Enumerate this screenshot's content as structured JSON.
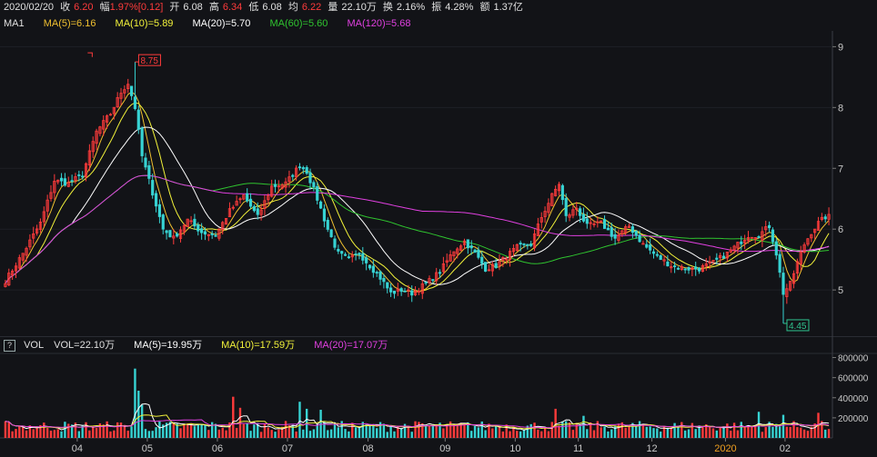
{
  "header": {
    "date": "2020/02/20",
    "items": [
      {
        "label": "收",
        "value": "6.20",
        "color": "#ff3b3b"
      },
      {
        "label": "幅",
        "value": "1.97%[0.12]",
        "color": "#ff3b3b"
      },
      {
        "label": "开",
        "value": "6.08",
        "color": "#e0e0e0"
      },
      {
        "label": "高",
        "value": "6.34",
        "color": "#ff3b3b"
      },
      {
        "label": "低",
        "value": "6.08",
        "color": "#e0e0e0"
      },
      {
        "label": "均",
        "value": "6.22",
        "color": "#ff3b3b"
      },
      {
        "label": "量",
        "value": "22.10万",
        "color": "#e0e0e0"
      },
      {
        "label": "换",
        "value": "2.16%",
        "color": "#e0e0e0"
      },
      {
        "label": "振",
        "value": "4.28%",
        "color": "#e0e0e0"
      },
      {
        "label": "额",
        "value": "1.37亿",
        "color": "#e0e0e0"
      }
    ]
  },
  "ma_legend": {
    "name": "MA1",
    "items": [
      {
        "text": "MA(5)=6.16",
        "color": "#f0c030"
      },
      {
        "text": "MA(10)=5.89",
        "color": "#f2f23a"
      },
      {
        "text": "MA(20)=5.70",
        "color": "#ffffff"
      },
      {
        "text": "MA(60)=5.60",
        "color": "#2fc42f"
      },
      {
        "text": "MA(120)=5.68",
        "color": "#e040e0"
      }
    ]
  },
  "vol_legend": {
    "help": "?",
    "name": "VOL",
    "items": [
      {
        "text": "VOL=22.10万",
        "color": "#e0e0e0"
      },
      {
        "text": "MA(5)=19.95万",
        "color": "#ffffff"
      },
      {
        "text": "MA(10)=17.59万",
        "color": "#f2f23a"
      },
      {
        "text": "MA(20)=17.07万",
        "color": "#e040e0"
      }
    ]
  },
  "chart_data": {
    "type": "candlestick",
    "price_axis": {
      "ticks": [
        "9",
        "8",
        "7",
        "6",
        "5"
      ],
      "tick_values": [
        9,
        8,
        7,
        6,
        5
      ],
      "range": [
        4.3,
        9.2
      ]
    },
    "volume_axis": {
      "ticks": [
        "800000",
        "600000",
        "400000",
        "200000"
      ],
      "tick_values": [
        800000,
        600000,
        400000,
        200000
      ],
      "range": [
        0,
        850000
      ]
    },
    "months": [
      {
        "label": "04",
        "index": 21,
        "color": "#c8c8c8"
      },
      {
        "label": "05",
        "index": 41,
        "color": "#c8c8c8"
      },
      {
        "label": "06",
        "index": 61,
        "color": "#c8c8c8"
      },
      {
        "label": "07",
        "index": 81,
        "color": "#c8c8c8"
      },
      {
        "label": "08",
        "index": 104,
        "color": "#c8c8c8"
      },
      {
        "label": "09",
        "index": 126,
        "color": "#c8c8c8"
      },
      {
        "label": "10",
        "index": 146,
        "color": "#c8c8c8"
      },
      {
        "label": "11",
        "index": 164,
        "color": "#c8c8c8"
      },
      {
        "label": "12",
        "index": 185,
        "color": "#c8c8c8"
      },
      {
        "label": "2020",
        "index": 206,
        "color": "#f0a020"
      },
      {
        "label": "02",
        "index": 223,
        "color": "#c8c8c8"
      }
    ],
    "annotations": [
      {
        "text": "8.75",
        "index": 37,
        "price": 8.75,
        "kind": "high",
        "color": "#ff3b3b"
      },
      {
        "text": "4.45",
        "index": 222,
        "price": 4.45,
        "kind": "low",
        "color": "#2fc48f"
      }
    ],
    "key_closes": [
      {
        "i": 0,
        "p": 5.15
      },
      {
        "i": 5,
        "p": 5.6
      },
      {
        "i": 10,
        "p": 6.1
      },
      {
        "i": 14,
        "p": 6.8
      },
      {
        "i": 18,
        "p": 6.75
      },
      {
        "i": 22,
        "p": 6.9
      },
      {
        "i": 26,
        "p": 7.6
      },
      {
        "i": 30,
        "p": 7.9
      },
      {
        "i": 33,
        "p": 8.25
      },
      {
        "i": 35,
        "p": 8.4
      },
      {
        "i": 37,
        "p": 8.0
      },
      {
        "i": 39,
        "p": 7.2
      },
      {
        "i": 42,
        "p": 6.6
      },
      {
        "i": 45,
        "p": 6.0
      },
      {
        "i": 48,
        "p": 5.85
      },
      {
        "i": 52,
        "p": 6.15
      },
      {
        "i": 56,
        "p": 5.95
      },
      {
        "i": 60,
        "p": 5.9
      },
      {
        "i": 64,
        "p": 6.3
      },
      {
        "i": 68,
        "p": 6.55
      },
      {
        "i": 72,
        "p": 6.2
      },
      {
        "i": 76,
        "p": 6.7
      },
      {
        "i": 80,
        "p": 6.75
      },
      {
        "i": 84,
        "p": 7.05
      },
      {
        "i": 86,
        "p": 6.95
      },
      {
        "i": 89,
        "p": 6.5
      },
      {
        "i": 92,
        "p": 6.0
      },
      {
        "i": 95,
        "p": 5.6
      },
      {
        "i": 98,
        "p": 5.5
      },
      {
        "i": 101,
        "p": 5.6
      },
      {
        "i": 104,
        "p": 5.4
      },
      {
        "i": 107,
        "p": 5.2
      },
      {
        "i": 110,
        "p": 4.95
      },
      {
        "i": 113,
        "p": 5.0
      },
      {
        "i": 116,
        "p": 4.95
      },
      {
        "i": 120,
        "p": 5.1
      },
      {
        "i": 124,
        "p": 5.3
      },
      {
        "i": 128,
        "p": 5.65
      },
      {
        "i": 131,
        "p": 5.8
      },
      {
        "i": 134,
        "p": 5.6
      },
      {
        "i": 137,
        "p": 5.35
      },
      {
        "i": 140,
        "p": 5.4
      },
      {
        "i": 143,
        "p": 5.55
      },
      {
        "i": 146,
        "p": 5.7
      },
      {
        "i": 150,
        "p": 5.75
      },
      {
        "i": 153,
        "p": 6.2
      },
      {
        "i": 156,
        "p": 6.55
      },
      {
        "i": 158,
        "p": 6.75
      },
      {
        "i": 160,
        "p": 6.2
      },
      {
        "i": 163,
        "p": 6.35
      },
      {
        "i": 166,
        "p": 6.05
      },
      {
        "i": 170,
        "p": 6.1
      },
      {
        "i": 174,
        "p": 5.85
      },
      {
        "i": 178,
        "p": 6.05
      },
      {
        "i": 182,
        "p": 5.75
      },
      {
        "i": 186,
        "p": 5.55
      },
      {
        "i": 190,
        "p": 5.4
      },
      {
        "i": 194,
        "p": 5.35
      },
      {
        "i": 198,
        "p": 5.35
      },
      {
        "i": 202,
        "p": 5.45
      },
      {
        "i": 206,
        "p": 5.6
      },
      {
        "i": 209,
        "p": 5.75
      },
      {
        "i": 212,
        "p": 5.9
      },
      {
        "i": 215,
        "p": 5.9
      },
      {
        "i": 218,
        "p": 6.05
      },
      {
        "i": 220,
        "p": 5.6
      },
      {
        "i": 222,
        "p": 4.95
      },
      {
        "i": 224,
        "p": 5.1
      },
      {
        "i": 226,
        "p": 5.45
      },
      {
        "i": 228,
        "p": 5.75
      },
      {
        "i": 230,
        "p": 5.95
      },
      {
        "i": 232,
        "p": 6.1
      },
      {
        "i": 234,
        "p": 6.2
      }
    ],
    "volume_spikes": [
      {
        "i": 37,
        "v": 690000
      },
      {
        "i": 38,
        "v": 470000
      },
      {
        "i": 39,
        "v": 330000
      },
      {
        "i": 65,
        "v": 410000
      },
      {
        "i": 67,
        "v": 300000
      },
      {
        "i": 84,
        "v": 360000
      },
      {
        "i": 86,
        "v": 290000
      },
      {
        "i": 90,
        "v": 280000
      },
      {
        "i": 157,
        "v": 290000
      },
      {
        "i": 165,
        "v": 220000
      },
      {
        "i": 215,
        "v": 260000
      },
      {
        "i": 222,
        "v": 230000
      },
      {
        "i": 232,
        "v": 250000
      }
    ],
    "colors": {
      "up": "#ff3b3b",
      "down": "#37d3d3",
      "background": "#121317",
      "axis_text": "#c8c8c8"
    }
  }
}
